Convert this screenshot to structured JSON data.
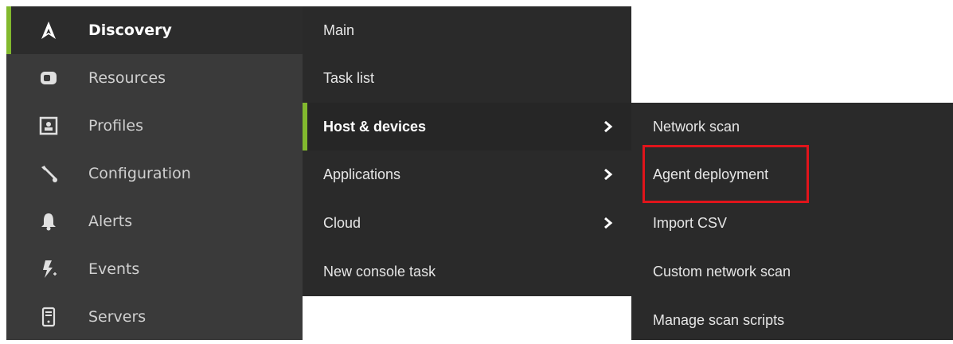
{
  "sidebar": {
    "accent": "#82b92e",
    "items": [
      {
        "label": "Discovery",
        "icon": "discovery-logo-icon",
        "active": true
      },
      {
        "label": "Resources",
        "icon": "resources-icon"
      },
      {
        "label": "Profiles",
        "icon": "profile-card-icon"
      },
      {
        "label": "Configuration",
        "icon": "wrench-icon"
      },
      {
        "label": "Alerts",
        "icon": "bell-icon"
      },
      {
        "label": "Events",
        "icon": "lightning-icon"
      },
      {
        "label": "Servers",
        "icon": "server-icon"
      }
    ]
  },
  "submenu": {
    "items": [
      {
        "label": "Main"
      },
      {
        "label": "Task list"
      },
      {
        "label": "Host & devices",
        "active": true,
        "has_children": true
      },
      {
        "label": "Applications",
        "has_children": true
      },
      {
        "label": "Cloud",
        "has_children": true
      },
      {
        "label": "New console task"
      }
    ]
  },
  "flyout": {
    "items": [
      {
        "label": "Network scan"
      },
      {
        "label": "Agent deployment",
        "highlighted": true
      },
      {
        "label": "Import CSV"
      },
      {
        "label": "Custom network scan"
      },
      {
        "label": "Manage scan scripts"
      }
    ],
    "highlight_color": "#e0141b"
  }
}
